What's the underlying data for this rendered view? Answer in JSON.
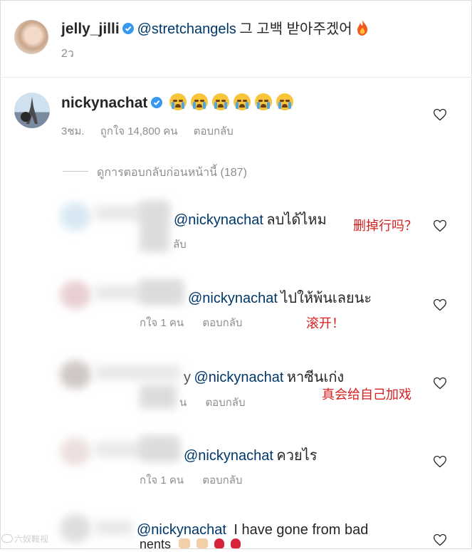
{
  "comment_top": {
    "username": "jelly_jilli",
    "mention": "@stretchangels",
    "text": "그 고백 받아주겠어",
    "time": "2ว"
  },
  "comment_main": {
    "username": "nickynachat",
    "time": "3ชม.",
    "likes": "ถูกใจ 14,800 คน",
    "reply_label": "ตอบกลับ",
    "view_previous": "ดูการตอบกลับก่อนหน้านี้ (187)"
  },
  "replies": [
    {
      "mention": "@nickynachat",
      "text": "ลบได้ไหม",
      "meta_fragment": "ลับ",
      "annotation": "删掉行吗？"
    },
    {
      "mention": "@nickynachat",
      "text": "ไปให้พ้นเลยนะ",
      "likes": "กใจ 1 คน",
      "reply_label": "ตอบกลับ",
      "annotation": "滚开！"
    },
    {
      "name_fragment": "y",
      "mention": "@nickynachat",
      "text": "หาซีนเก่ง",
      "meta_fragment": "น",
      "reply_label": "ตอบกลับ",
      "annotation": "真会给自己加戏"
    },
    {
      "mention": "@nickynachat",
      "text": "ควยไร",
      "likes": "กใจ 1 คน",
      "reply_label": "ตอบกลับ"
    },
    {
      "mention": "@nickynachat",
      "text": "I have gone from bad",
      "text_line2": "nents"
    }
  ],
  "watermark": "六奴鞍视",
  "icons": [
    "verified-icon",
    "heart-icon",
    "fire-emoji",
    "crying-emoji"
  ]
}
